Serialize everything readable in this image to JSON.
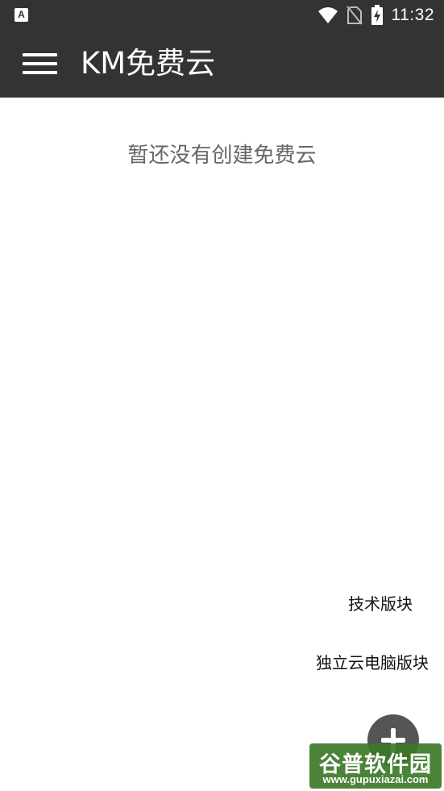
{
  "status_bar": {
    "left_icon": "A",
    "icons": [
      "wifi-icon",
      "no-sim-icon",
      "battery-charging-icon"
    ],
    "time": "11:32"
  },
  "toolbar": {
    "title": "KM免费云",
    "menu_icon": "hamburger-menu-icon"
  },
  "main": {
    "empty_message": "暂还没有创建免费云"
  },
  "fab_menu": {
    "items": [
      {
        "label": "技术版块"
      },
      {
        "label": "独立云电脑版块"
      }
    ],
    "fab_icon": "plus-icon"
  },
  "watermark": {
    "text": "谷普软件园",
    "url": "www.gupuxiazai.com"
  },
  "colors": {
    "toolbar": "#333333",
    "background": "#ffffff",
    "empty_text": "#666666",
    "fab": "#555555",
    "watermark": "#3c7828"
  }
}
